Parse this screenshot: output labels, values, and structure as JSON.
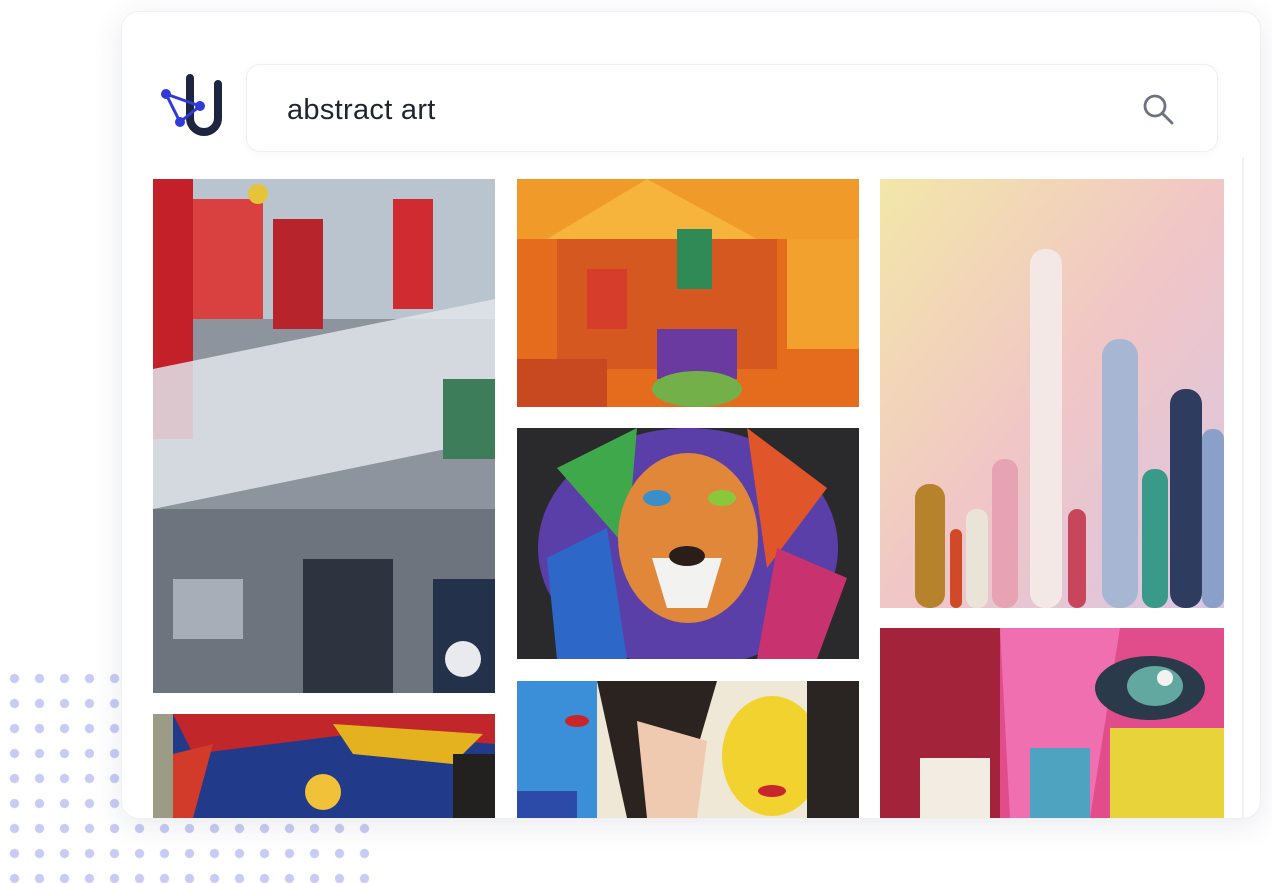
{
  "search": {
    "query": "abstract art"
  },
  "brand": {
    "primary": "#2f3ad8",
    "dark": "#1e2540"
  },
  "icons": {
    "search": "search-icon",
    "logo": "logo-icon"
  },
  "results": [
    {
      "column": 1,
      "subject": "abstract-splatter-painting"
    },
    {
      "column": 1,
      "subject": "abstract-blue-yellow-painting"
    },
    {
      "column": 2,
      "subject": "orange-house-painting"
    },
    {
      "column": 2,
      "subject": "colorful-lion-painting"
    },
    {
      "column": 2,
      "subject": "cubist-faces-painting"
    },
    {
      "column": 3,
      "subject": "drip-paint-painting"
    },
    {
      "column": 3,
      "subject": "colorful-face-eye-painting"
    }
  ]
}
